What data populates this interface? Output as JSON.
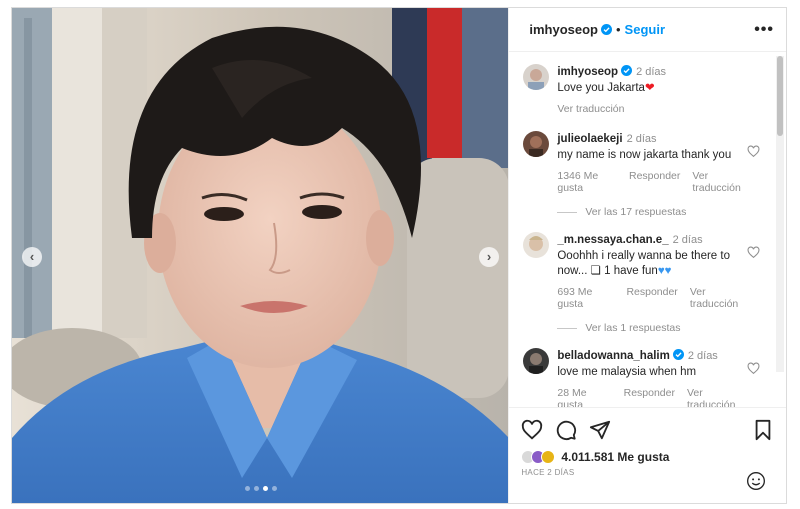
{
  "post": {
    "author": "imhyoseop",
    "follow_label": "Seguir",
    "separator": "•",
    "more_label": "•••"
  },
  "caption": {
    "user": "imhyoseop",
    "time": "2 días",
    "text": "Love you Jakarta",
    "translate": "Ver traducción"
  },
  "comments": [
    {
      "user": "julieolaekeji",
      "time": "2 días",
      "text": "my name is now jakarta thank you",
      "likes": "1346 Me gusta",
      "reply": "Responder",
      "translate": "Ver traducción",
      "replies": "Ver las 17 respuestas"
    },
    {
      "user": "_m.nessaya.chan.e_",
      "time": "2 días",
      "text": "Ooohhh i really wanna be there to now... ❏ 1 have fun",
      "likes": "693 Me gusta",
      "reply": "Responder",
      "translate": "Ver traducción",
      "replies": "Ver las 1 respuestas"
    },
    {
      "user": "belladowanna_halim",
      "time": "2 días",
      "text": "love me malaysia when hm",
      "likes": "28 Me gusta",
      "reply": "Responder",
      "translate": "Ver traducción"
    }
  ],
  "stats": {
    "likes": "4.011.581 Me gusta",
    "when": "HACE 2 DÍAS"
  },
  "carousel": {
    "current": 2,
    "total": 4
  },
  "colors": {
    "accent": "#0095f6",
    "verified": "#0095f6",
    "heart_red": "#ed1c24",
    "blue_heart": "#3897f0"
  }
}
